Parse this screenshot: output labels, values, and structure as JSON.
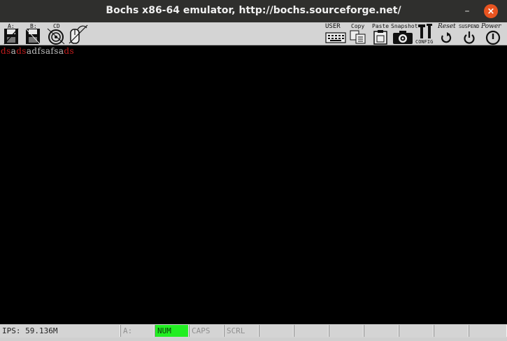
{
  "window": {
    "title": "Bochs x86-64 emulator, http://bochs.sourceforge.net/",
    "minimize_glyph": "–",
    "close_glyph": "×"
  },
  "toolbar": {
    "floppy_a_label": "A:",
    "floppy_b_label": "B:",
    "cdrom_label": "CD",
    "user_label": "USER",
    "copy_label": "Copy",
    "paste_label": "Paste",
    "snapshot_label": "Snapshot",
    "config_label": "CONFIG",
    "reset_label": "Reset",
    "suspend_label": "SUSPEND",
    "power_label": "Power"
  },
  "screen": {
    "segments": [
      {
        "text": "ds",
        "color": "red"
      },
      {
        "text": "a",
        "color": "gray"
      },
      {
        "text": "ds",
        "color": "red"
      },
      {
        "text": "adfsafsa",
        "color": "gray"
      },
      {
        "text": "ds",
        "color": "red"
      }
    ],
    "colors": {
      "red": "#c21d1d",
      "gray": "#c0c0c0",
      "background": "#000000"
    }
  },
  "statusbar": {
    "ips": "IPS: 59.136M",
    "drive": "A:",
    "num": "NUM",
    "caps": "CAPS",
    "scrl": "SCRL",
    "num_on_color": "#22ee22"
  }
}
